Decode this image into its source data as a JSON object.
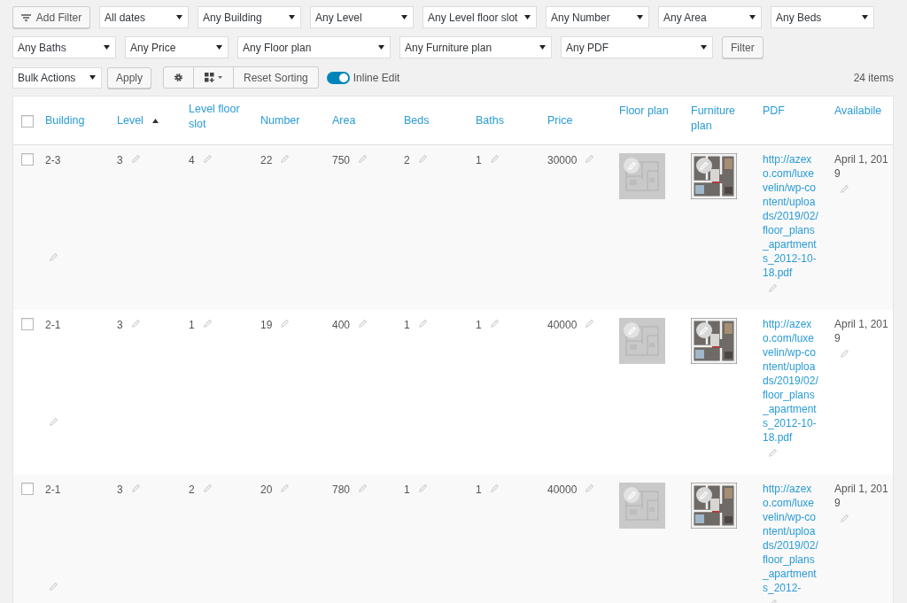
{
  "add_filter": {
    "label": "Add Filter"
  },
  "filters": [
    {
      "value": "All dates"
    },
    {
      "value": "Any Building"
    },
    {
      "value": "Any Level"
    },
    {
      "value": "Any Level floor slot"
    },
    {
      "value": "Any Number"
    },
    {
      "value": "Any Area"
    },
    {
      "value": "Any Beds"
    },
    {
      "value": "Any Baths"
    },
    {
      "value": "Any Price"
    },
    {
      "value": "Any Floor plan"
    },
    {
      "value": "Any Furniture plan"
    },
    {
      "value": "Any PDF"
    }
  ],
  "filter_button": "Filter",
  "toolbar": {
    "bulk_actions": "Bulk Actions",
    "apply": "Apply",
    "reset_sorting": "Reset Sorting",
    "inline_edit": {
      "label": "Inline Edit",
      "on": true
    },
    "count": "24 items"
  },
  "table": {
    "select_all": {
      "checked": false
    },
    "columns": [
      {
        "label": "Building",
        "sorted": false
      },
      {
        "label": "Level",
        "sorted": true
      },
      {
        "label": "Level floor slot",
        "sorted": false
      },
      {
        "label": "Number",
        "sorted": false
      },
      {
        "label": "Area",
        "sorted": false
      },
      {
        "label": "Beds",
        "sorted": false
      },
      {
        "label": "Baths",
        "sorted": false
      },
      {
        "label": "Price",
        "sorted": false
      },
      {
        "label": "Floor plan",
        "sorted": false
      },
      {
        "label": "Furniture plan",
        "sorted": false
      },
      {
        "label": "PDF",
        "sorted": false
      },
      {
        "label": "Availabile",
        "sorted": false
      }
    ],
    "rows": [
      {
        "checked": false,
        "building": "2-3",
        "level": "3",
        "slot": "4",
        "number": "22",
        "area": "750",
        "beds": "2",
        "baths": "1",
        "price": "30000",
        "pdf": "http://azexo.com/luxevelin/wp-content/uploads/2019/02/floor_plans_apartments_2012-10-18.pdf",
        "available": "April 1, 2019"
      },
      {
        "checked": false,
        "building": "2-1",
        "level": "3",
        "slot": "1",
        "number": "19",
        "area": "400",
        "beds": "1",
        "baths": "1",
        "price": "40000",
        "pdf": "http://azexo.com/luxevelin/wp-content/uploads/2019/02/floor_plans_apartments_2012-10-18.pdf",
        "available": "April 1, 2019"
      },
      {
        "checked": false,
        "building": "2-1",
        "level": "3",
        "slot": "2",
        "number": "20",
        "area": "780",
        "beds": "1",
        "baths": "1",
        "price": "40000",
        "pdf": "http://azexo.com/luxevelin/wp-content/uploads/2019/02/floor_plans_apartments_2012-",
        "available": "April 1, 2019"
      }
    ]
  }
}
